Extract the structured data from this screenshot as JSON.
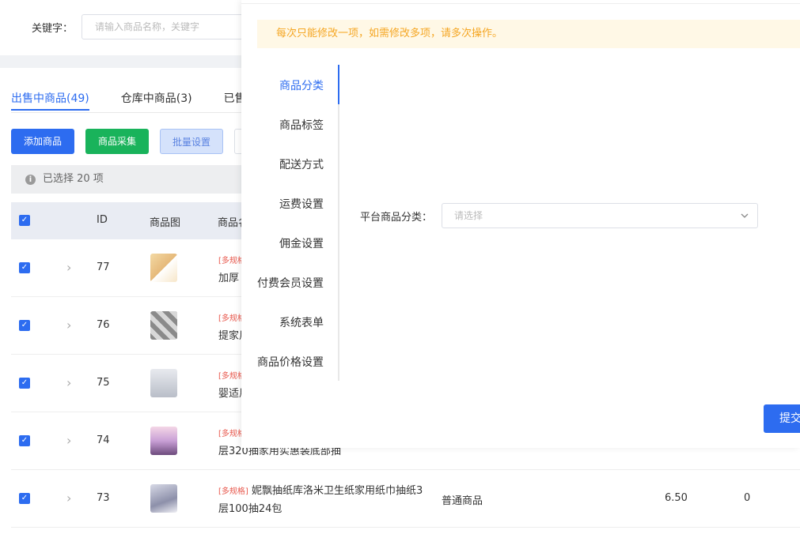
{
  "filter": {
    "label": "关键字：",
    "placeholder": "请输入商品名称，关键字"
  },
  "tabs": [
    {
      "label": "出售中商品(49)",
      "active": true
    },
    {
      "label": "仓库中商品(3)",
      "active": false
    },
    {
      "label": "已售",
      "active": false
    }
  ],
  "toolbar": {
    "add_label": "添加商品",
    "collect_label": "商品采集",
    "batch_label": "批量设置"
  },
  "selection": {
    "text": "已选择 20 项",
    "info_icon": "i"
  },
  "table": {
    "headers": {
      "id": "ID",
      "image": "商品图",
      "name": "商品名"
    },
    "rows": [
      {
        "id": "77",
        "tag": "[多规格]",
        "name": "加厚",
        "type": "",
        "price": "",
        "sales": ""
      },
      {
        "id": "76",
        "tag": "[多规格]",
        "name": "提家用",
        "type": "",
        "price": "",
        "sales": ""
      },
      {
        "id": "75",
        "tag": "[多规格]",
        "name": "婴适用",
        "type": "",
        "price": "",
        "sales": ""
      },
      {
        "id": "74",
        "tag": "[多规格]",
        "name": "层320抽家用实惠装底部抽",
        "type": "",
        "price": "",
        "sales": ""
      },
      {
        "id": "73",
        "tag": "[多规格]",
        "name": "妮飘抽纸库洛米卫生纸家用纸巾抽纸3层100抽24包",
        "type": "普通商品",
        "price": "6.50",
        "sales": "0"
      }
    ]
  },
  "modal": {
    "alert": "每次只能修改一项，如需修改多项，请多次操作。",
    "nav": [
      {
        "label": "商品分类",
        "active": true
      },
      {
        "label": "商品标签",
        "active": false
      },
      {
        "label": "配送方式",
        "active": false
      },
      {
        "label": "运费设置",
        "active": false
      },
      {
        "label": "佣金设置",
        "active": false
      },
      {
        "label": "付费会员设置",
        "active": false
      },
      {
        "label": "系统表单",
        "active": false
      },
      {
        "label": "商品价格设置",
        "active": false
      }
    ],
    "form": {
      "label": "平台商品分类：",
      "placeholder": "请选择"
    },
    "submit_label": "提交"
  },
  "colors": {
    "primary": "#2d6cf0",
    "success": "#19b35b",
    "warning": "#f5a623",
    "tag": "#e85a4f"
  }
}
